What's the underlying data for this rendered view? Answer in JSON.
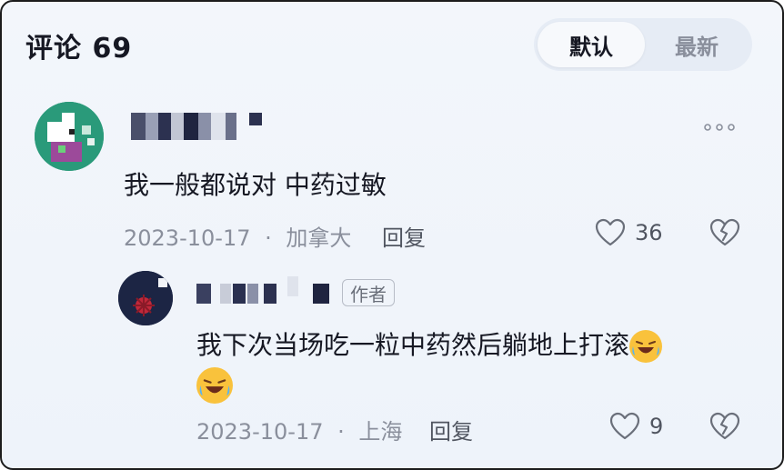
{
  "header": {
    "title": "评论 69",
    "sort_default": "默认",
    "sort_latest": "最新"
  },
  "comments": [
    {
      "text": "我一般都说对 中药过敏",
      "date": "2023-10-17",
      "location": "加拿大",
      "separator": "·",
      "reply_label": "回复",
      "likes": "36",
      "icons": [
        "more-icon",
        "heart-icon",
        "broken-heart-icon"
      ]
    },
    {
      "text": "我下次当场吃一粒中药然后躺地上打滚",
      "badge": "作者",
      "date": "2023-10-17",
      "location": "上海",
      "separator": "·",
      "reply_label": "回复",
      "likes": "9",
      "icons": [
        "laughing-crying-emoji",
        "laughing-crying-emoji",
        "heart-icon",
        "broken-heart-icon"
      ]
    }
  ],
  "colors": {
    "text_primary": "#161823",
    "text_secondary": "#8a8f9c",
    "background": "#eef3fa"
  }
}
